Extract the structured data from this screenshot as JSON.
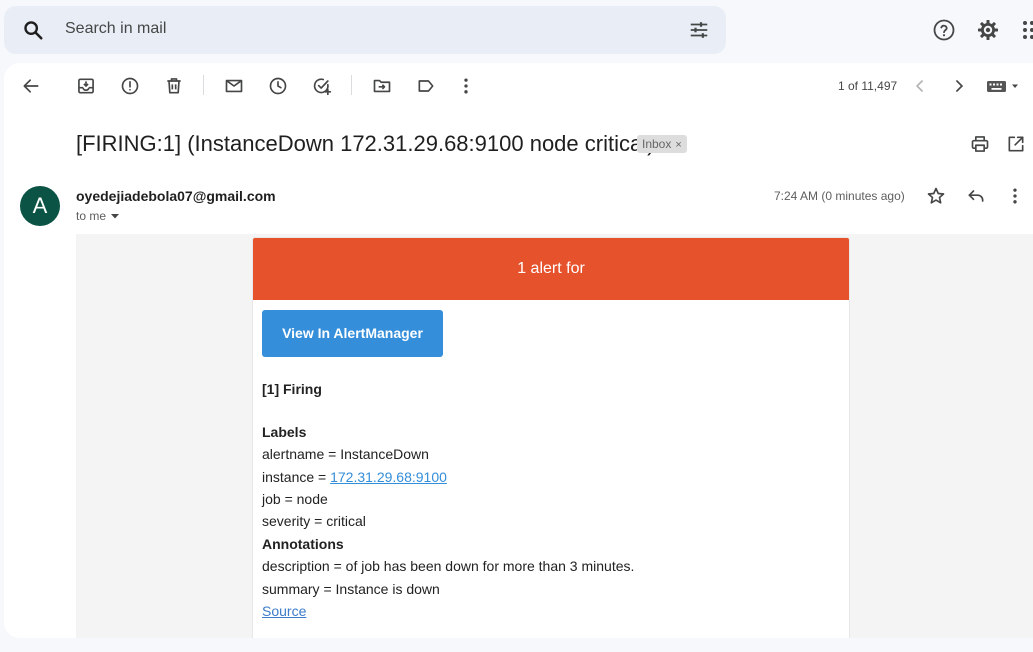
{
  "search": {
    "placeholder": "Search in mail"
  },
  "toolbar": {
    "pagination": "1 of 11,497"
  },
  "email": {
    "subject": "[FIRING:1] (InstanceDown 172.31.29.68:9100 node critical)",
    "label_chip": "Inbox",
    "label_chip_close": "×",
    "avatar_letter": "A",
    "sender": "oyedejiadebola07@gmail.com",
    "recipient": "to me",
    "time": "7:24 AM (0 minutes ago)"
  },
  "alert": {
    "header": "1 alert for",
    "header_color": "#e6522c",
    "button_label": "View In AlertManager",
    "button_color": "#348eda",
    "firing_title": "[1] Firing",
    "labels_title": "Labels",
    "alertname_line": "alertname = InstanceDown",
    "instance_prefix": "instance = ",
    "instance_link": "172.31.29.68:9100",
    "job_line": "job = node",
    "severity_line": "severity = critical",
    "annotations_title": "Annotations",
    "description_line": "description = of job has been down for more than 3 minutes.",
    "summary_line": "summary = Instance is down",
    "source_link": "Source"
  },
  "icons": [
    "search-icon",
    "tune-icon",
    "help-icon",
    "settings-icon",
    "apps-icon",
    "back-arrow-icon",
    "archive-icon",
    "report-spam-icon",
    "delete-icon",
    "mark-unread-icon",
    "snooze-icon",
    "add-task-icon",
    "move-to-icon",
    "label-icon",
    "more-vert-icon",
    "prev-page-icon",
    "next-page-icon",
    "keyboard-icon",
    "print-icon",
    "open-new-window-icon",
    "star-icon",
    "reply-icon"
  ]
}
